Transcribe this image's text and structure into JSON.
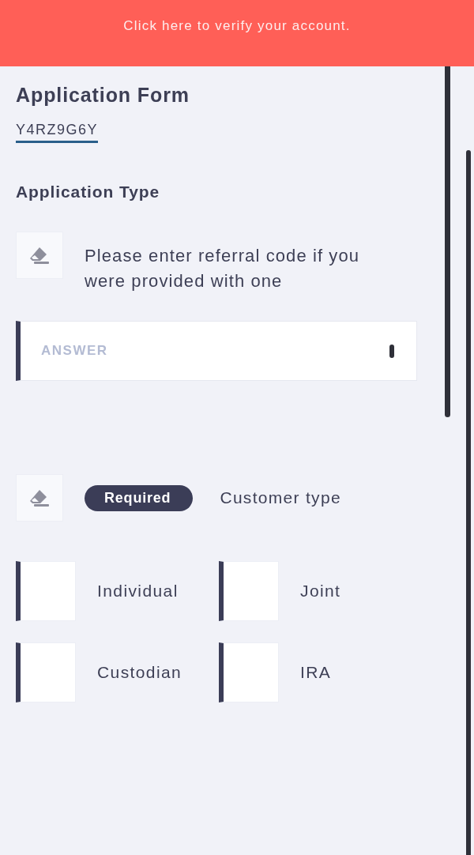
{
  "banner": {
    "text": "Click here to verify your account."
  },
  "form": {
    "title": "Application Form",
    "code": "Y4RZ9G6Y",
    "section_title": "Application Type"
  },
  "questions": [
    {
      "kind": "text",
      "prompt": "Please enter referral code if you were provided with one",
      "placeholder": "ANSWER"
    },
    {
      "kind": "choice",
      "badge": "Required",
      "prompt": "Customer type",
      "options": [
        {
          "label": "Individual",
          "checked": false
        },
        {
          "label": "Joint",
          "checked": false
        },
        {
          "label": "Custodian",
          "checked": false
        },
        {
          "label": "IRA",
          "checked": false
        }
      ]
    }
  ]
}
